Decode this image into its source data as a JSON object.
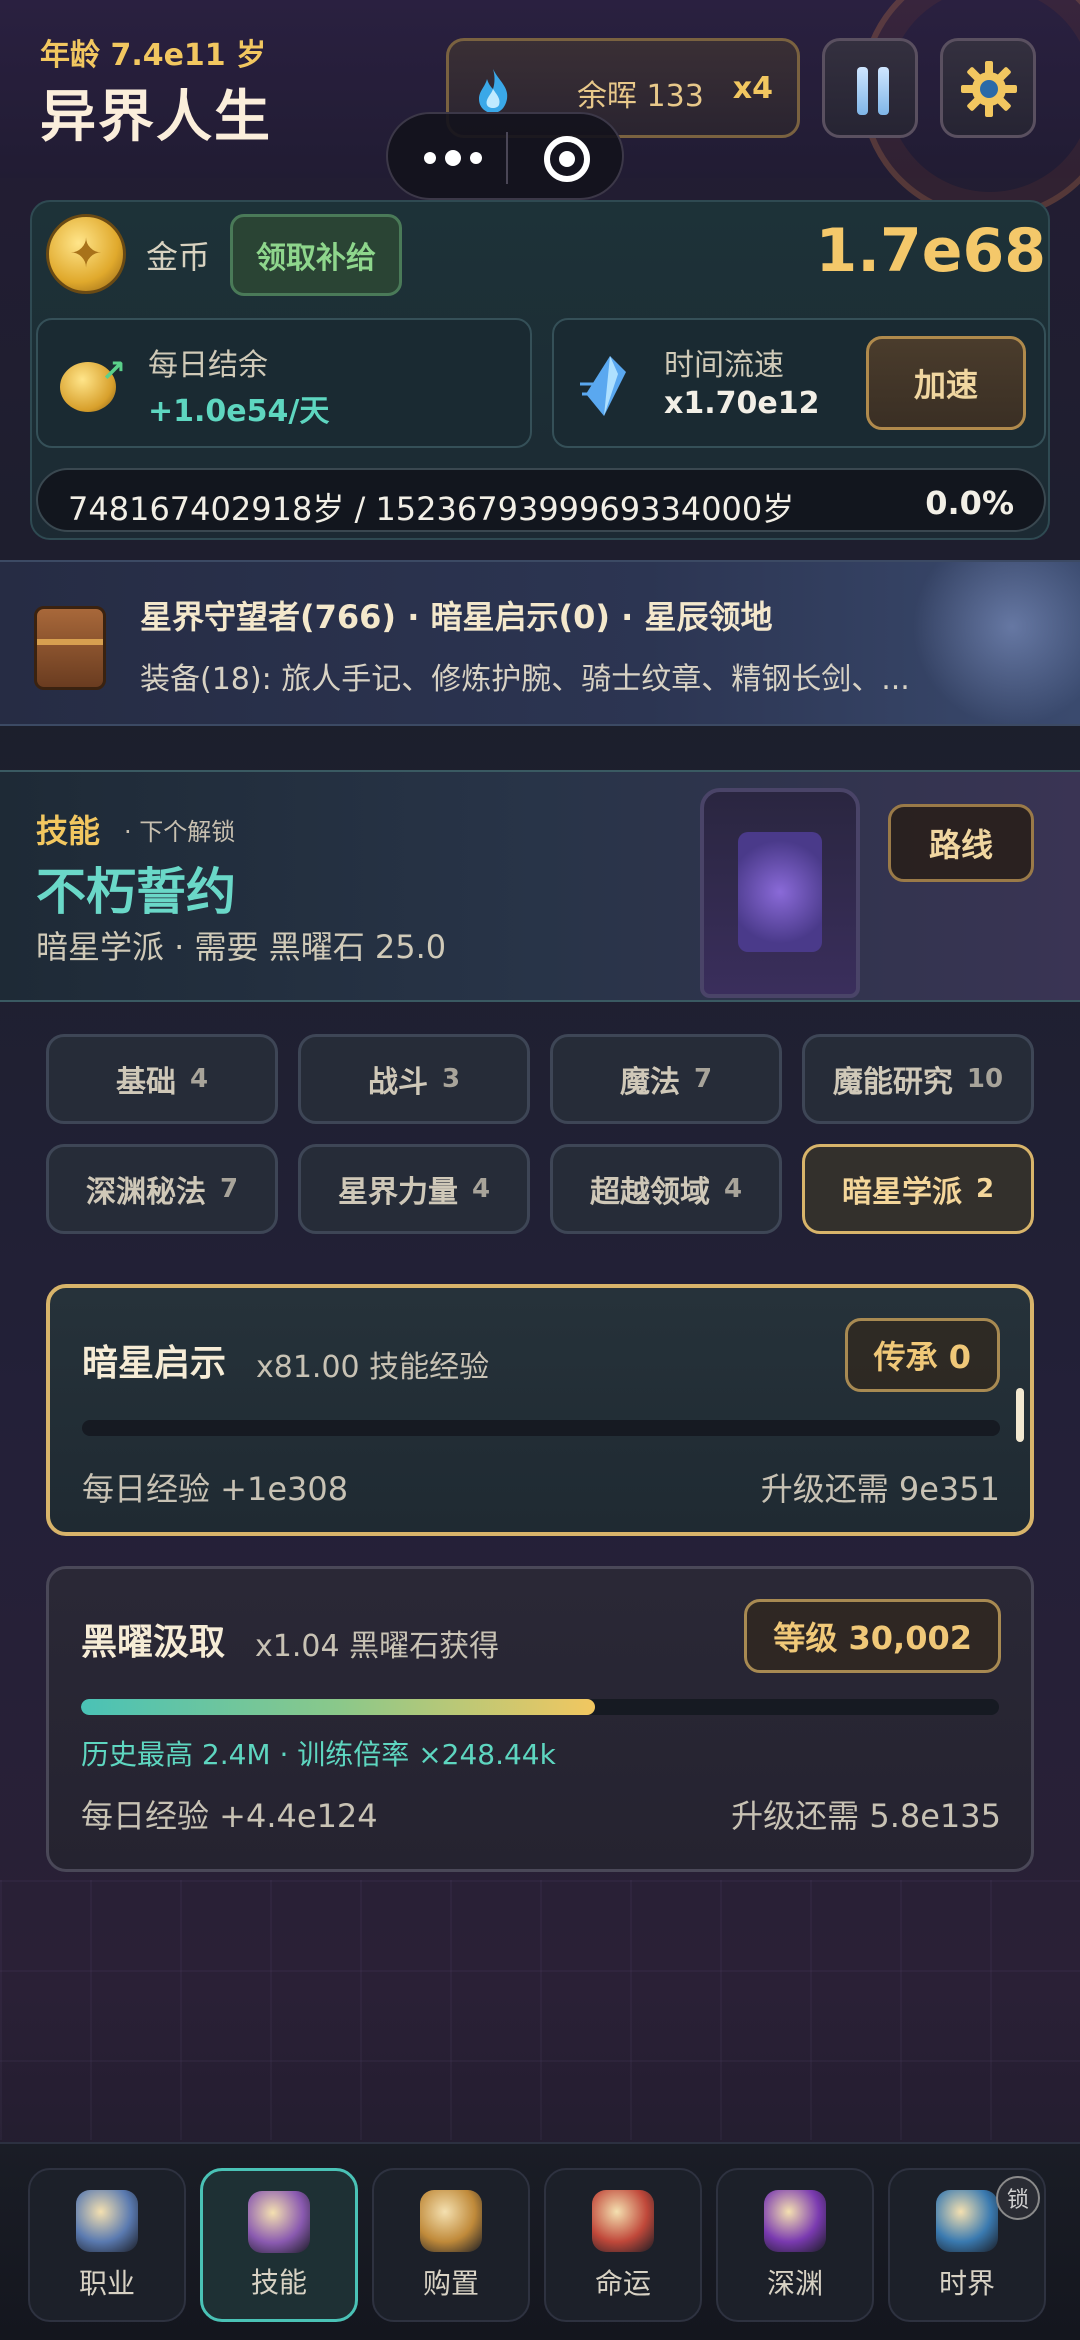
{
  "header": {
    "age": "年龄 7.4e11 岁",
    "title": "异界人生",
    "resource": {
      "label": "余晖 133",
      "multiplier": "x4"
    }
  },
  "gold": {
    "label": "金币",
    "claim_label": "领取补给",
    "value": "1.7e68",
    "daily": {
      "label": "每日结余",
      "value": "+1.0e54/天"
    },
    "time": {
      "label": "时间流速",
      "value": "x1.70e12",
      "speed_label": "加速"
    },
    "age_bar": {
      "text": "748167402918岁 / 152367939996933400​0岁",
      "percent": "0.0%"
    }
  },
  "character": {
    "titles": "星界守望者(766) · 暗星启示(0) · 星辰领地",
    "equipment": "装备(18): 旅人手记、修炼护腕、骑士纹章、精钢长剑、..."
  },
  "skill_header": {
    "tag": "技能",
    "next": "· 下个解锁",
    "name": "不朽誓约",
    "requirement": "暗星学派 · 需要 黑曜石 25.0",
    "route_label": "路线"
  },
  "tabs": [
    {
      "label": "基础",
      "count": "4"
    },
    {
      "label": "战斗",
      "count": "3"
    },
    {
      "label": "魔法",
      "count": "7"
    },
    {
      "label": "魔能研究",
      "count": "10"
    },
    {
      "label": "深渊秘法",
      "count": "7"
    },
    {
      "label": "星界力量",
      "count": "4"
    },
    {
      "label": "超越领域",
      "count": "4"
    },
    {
      "label": "暗星学派",
      "count": "2"
    }
  ],
  "active_tab": 7,
  "skills": [
    {
      "title": "暗星启示",
      "multiplier": "x81.00 技能经验",
      "badge": "传承 0",
      "progress": 0,
      "daily_xp": "每日经验 +1e308",
      "upgrade": "升级还需 9e351"
    },
    {
      "title": "黑曜汲取",
      "multiplier": "x1.04 黑曜石获得",
      "badge": "等级 30,002",
      "progress": 0.56,
      "history": "历史最高 2.4M · 训练倍率 ×248.44k",
      "daily_xp": "每日经验 +4.4e124",
      "upgrade": "升级还需 5.8e135"
    }
  ],
  "nav": [
    {
      "label": "职业",
      "icon": "shield-sword-icon",
      "color": "#5a7ab0"
    },
    {
      "label": "技能",
      "icon": "spellbook-icon",
      "color": "#8a5ab0"
    },
    {
      "label": "购置",
      "icon": "treasure-bag-icon",
      "color": "#c08a3a"
    },
    {
      "label": "命运",
      "icon": "fate-medallion-icon",
      "color": "#c0483a"
    },
    {
      "label": "深渊",
      "icon": "abyss-crystal-icon",
      "color": "#7a3ab0"
    },
    {
      "label": "时界",
      "icon": "time-realm-icon",
      "color": "#3a7ab0",
      "lock": "锁"
    }
  ],
  "active_nav": 1
}
